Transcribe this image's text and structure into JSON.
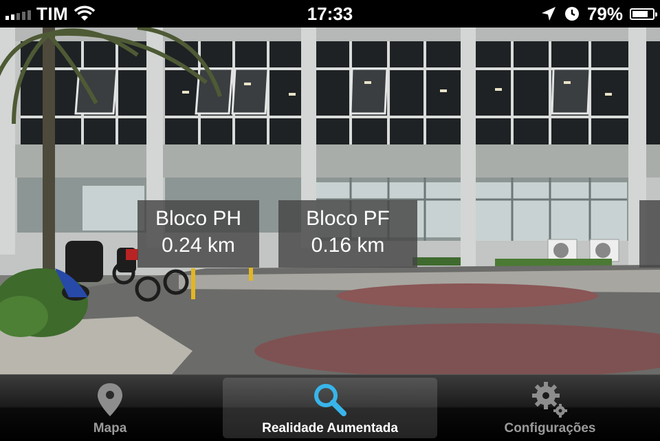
{
  "status_bar": {
    "carrier": "TIM",
    "time": "17:33",
    "battery_percent": "79%",
    "battery_level": 0.79,
    "signal_bars": 2
  },
  "ar_labels": [
    {
      "name": "Bloco PH",
      "distance": "0.24 km"
    },
    {
      "name": "Bloco PF",
      "distance": "0.16 km"
    }
  ],
  "tab_bar": {
    "tabs": [
      {
        "label": "Mapa",
        "icon": "map-pin-icon",
        "active": false
      },
      {
        "label": "Realidade Aumentada",
        "icon": "magnifier-icon",
        "active": true
      },
      {
        "label": "Configurações",
        "icon": "gear-icon",
        "active": false
      }
    ]
  },
  "colors": {
    "active_icon": "#38b5ea",
    "inactive_icon": "#9a9a9a"
  }
}
